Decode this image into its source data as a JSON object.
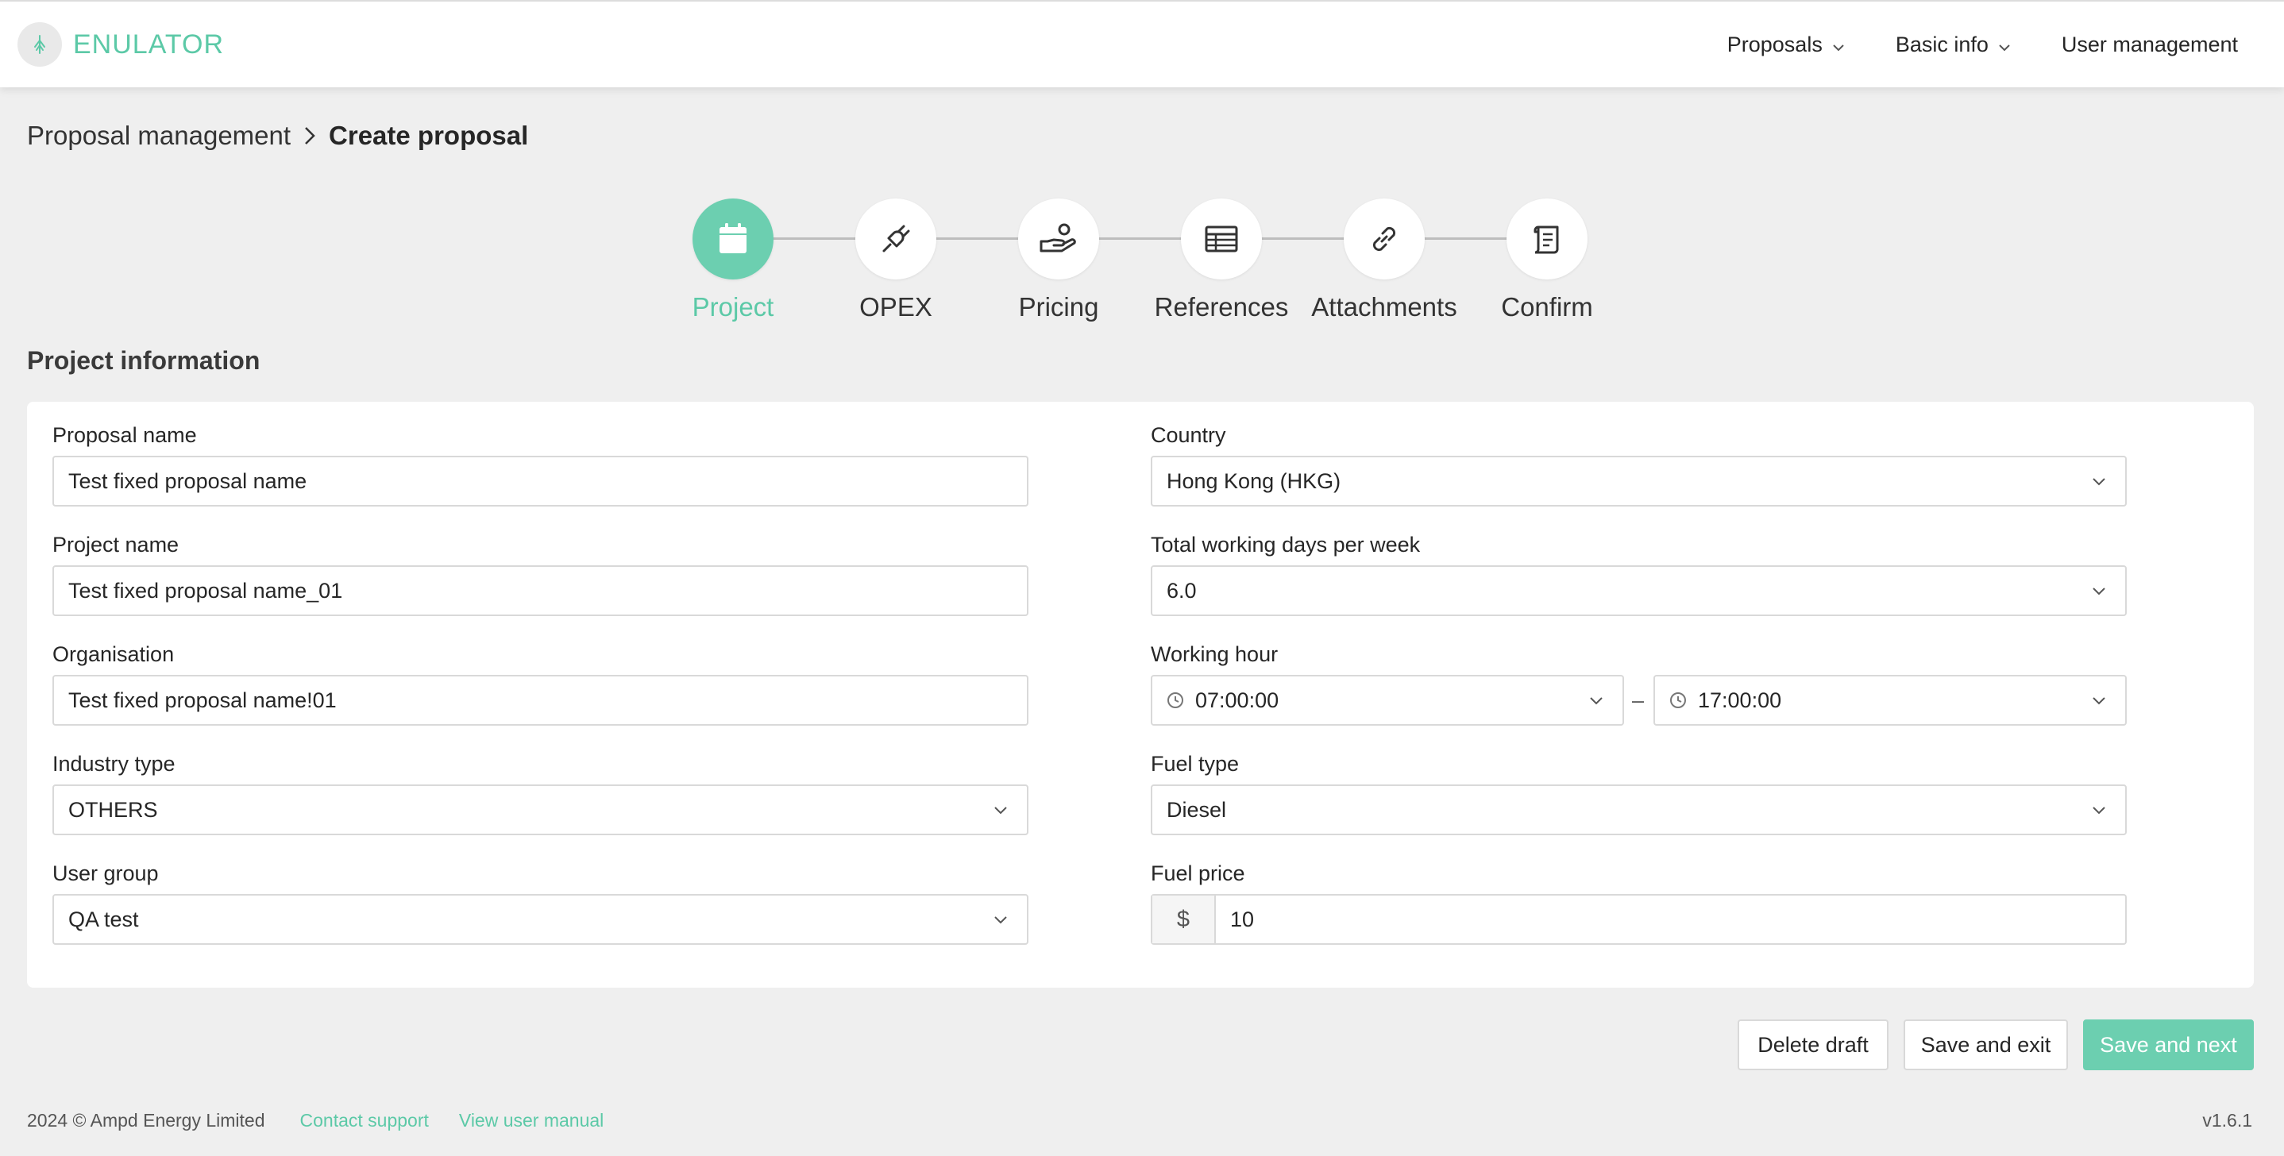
{
  "header": {
    "logo_text": "ENULATOR",
    "nav": [
      {
        "label": "Proposals",
        "has_dropdown": true
      },
      {
        "label": "Basic info",
        "has_dropdown": true
      },
      {
        "label": "User management",
        "has_dropdown": false
      }
    ]
  },
  "breadcrumb": {
    "parent": "Proposal management",
    "current": "Create proposal"
  },
  "steps": [
    {
      "label": "Project",
      "icon": "calendar-icon",
      "active": true
    },
    {
      "label": "OPEX",
      "icon": "plug-icon",
      "active": false
    },
    {
      "label": "Pricing",
      "icon": "hand-coin-icon",
      "active": false
    },
    {
      "label": "References",
      "icon": "table-icon",
      "active": false
    },
    {
      "label": "Attachments",
      "icon": "link-icon",
      "active": false
    },
    {
      "label": "Confirm",
      "icon": "scroll-icon",
      "active": false
    }
  ],
  "section_title": "Project information",
  "form": {
    "proposal_name": {
      "label": "Proposal name",
      "value": "Test fixed proposal name"
    },
    "project_name": {
      "label": "Project name",
      "value": "Test fixed proposal name_01"
    },
    "organisation": {
      "label": "Organisation",
      "value": "Test fixed proposal name!01"
    },
    "industry_type": {
      "label": "Industry type",
      "value": "OTHERS"
    },
    "user_group": {
      "label": "User group",
      "value": "QA test"
    },
    "country": {
      "label": "Country",
      "value": "Hong Kong (HKG)"
    },
    "working_days": {
      "label": "Total working days per week",
      "value": "6.0"
    },
    "working_hour": {
      "label": "Working hour",
      "start": "07:00:00",
      "separator": "–",
      "end": "17:00:00"
    },
    "fuel_type": {
      "label": "Fuel type",
      "value": "Diesel"
    },
    "fuel_price": {
      "label": "Fuel price",
      "prefix": "$",
      "value": "10"
    }
  },
  "actions": {
    "delete_draft": "Delete draft",
    "save_exit": "Save and exit",
    "save_next": "Save and next"
  },
  "footer": {
    "copyright": "2024 © Ampd Energy Limited",
    "contact": "Contact support",
    "manual": "View user manual",
    "version": "v1.6.1"
  },
  "colors": {
    "accent": "#6ccfb0",
    "accent_text": "#5cc9a7",
    "background": "#efefef"
  }
}
